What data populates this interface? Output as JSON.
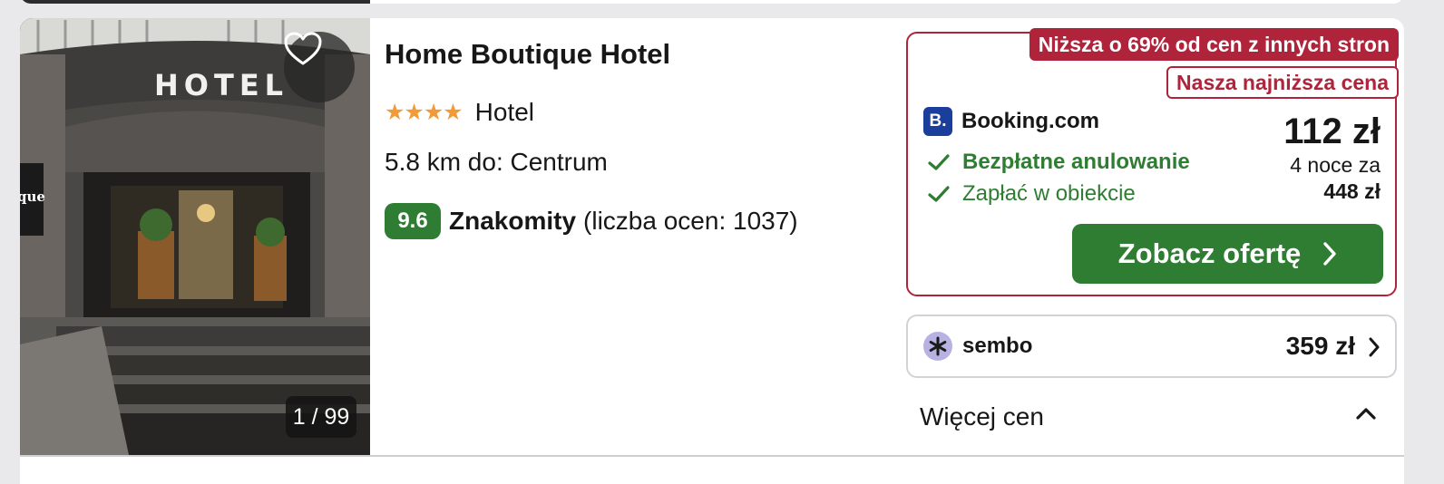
{
  "hotel": {
    "name": "Home Boutique Hotel",
    "stars": "★★★★",
    "type": "Hotel",
    "distance": "5.8 km do: Centrum",
    "rating_score": "9.6",
    "rating_word": "Znakomity",
    "rating_count": "(liczba ocen: 1037)",
    "photo_counter": "1 / 99",
    "photo_sign": "HOTEL",
    "photo_side_sign": "que"
  },
  "offer": {
    "badge_discount": "Niższa o 69% od cen z innych stron",
    "badge_lowest": "Nasza najniższa cena",
    "provider_logo": "B.",
    "provider_name": "Booking.com",
    "feature_1": "Bezpłatne anulowanie",
    "feature_2": "Zapłać w obiekcie",
    "price": "112 zł",
    "nights_label": "4 noce za",
    "total_price": "448 zł",
    "cta_label": "Zobacz ofertę"
  },
  "alt_offer": {
    "provider_name": "sembo",
    "price": "359 zł"
  },
  "more_prices": {
    "label": "Więcej cen"
  },
  "colors": {
    "accent_red": "#b0243b",
    "accent_green": "#2e7d32",
    "star": "#f39a38",
    "booking_blue": "#1b3d9b",
    "sembo_purple": "#b8b2e3"
  },
  "icons": [
    "heart-icon",
    "check-icon",
    "chevron-right-icon",
    "chevron-up-icon",
    "asterisk-icon"
  ]
}
